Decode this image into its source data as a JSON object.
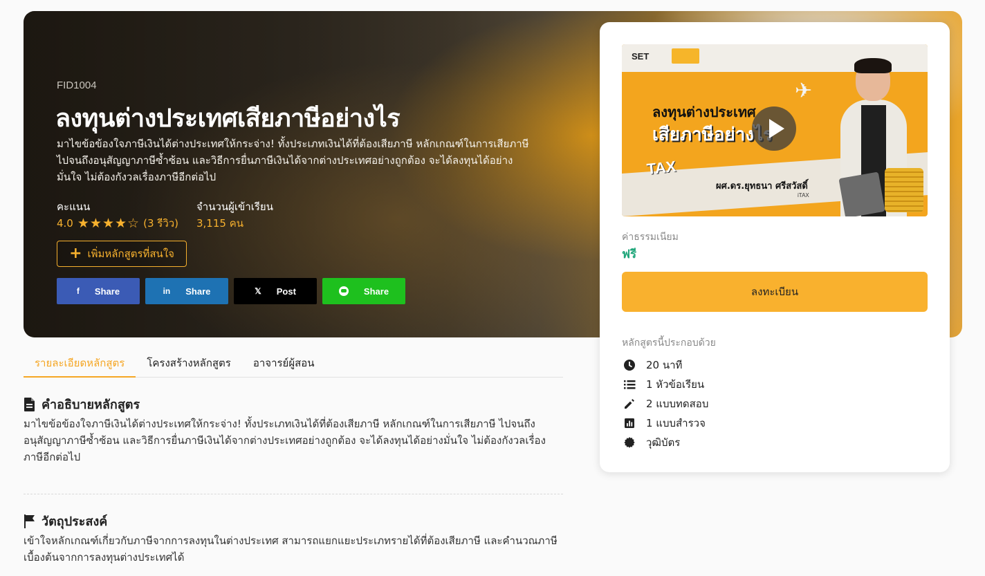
{
  "hero": {
    "code": "FID1004",
    "title": "ลงทุนต่างประเทศเสียภาษีอย่างไร",
    "description": "มาไขข้อข้องใจภาษีเงินได้ต่างประเทศให้กระจ่าง! ทั้งประเภทเงินได้ที่ต้องเสียภาษี หลักเกณฑ์ในการเสียภาษี ไปจนถึงอนุสัญญาภาษีซ้ำซ้อน และวิธีการยื่นภาษีเงินได้จากต่างประเทศอย่างถูกต้อง จะได้ลงทุนได้อย่างมั่นใจ ไม่ต้องกังวลเรื่องภาษีอีกต่อไป",
    "rating_label": "คะแนน",
    "rating_value": "4.0",
    "rating_stars": 4,
    "reviews": "(3 รีวิว)",
    "students_label": "จำนวนผู้เข้าเรียน",
    "students_value": "3,115 คน",
    "follow_label": "เพิ่มหลักสูตรที่สนใจ",
    "share": {
      "facebook": "Share",
      "linkedin": "Share",
      "x": "Post",
      "line": "Share"
    },
    "colors": {
      "accent": "#f7b12e",
      "facebook": "#3b5bb5",
      "linkedin": "#1e72b3",
      "x": "#000000",
      "line": "#1ec01e"
    }
  },
  "tabs": [
    "รายละเอียดหลักสูตร",
    "โครงสร้างหลักสูตร",
    "อาจารย์ผู้สอน"
  ],
  "description_section": {
    "heading": "คำอธิบายหลักสูตร",
    "text": "มาไขข้อข้องใจภาษีเงินได้ต่างประเทศให้กระจ่าง! ทั้งประเภทเงินได้ที่ต้องเสียภาษี หลักเกณฑ์ในการเสียภาษี ไปจนถึงอนุสัญญาภาษีซ้ำซ้อน และวิธีการยื่นภาษีเงินได้จากต่างประเทศอย่างถูกต้อง จะได้ลงทุนได้อย่างมั่นใจ ไม่ต้องกังวลเรื่องภาษีอีกต่อไป"
  },
  "objective_section": {
    "heading": "วัตถุประสงค์",
    "text": "เข้าใจหลักเกณฑ์เกี่ยวกับภาษีจากการลงทุนในต่างประเทศ สามารถแยกแยะประเภทรายได้ที่ต้องเสียภาษี และคำนวณภาษีเบื้องต้นจากการลงทุนต่างประเทศได้"
  },
  "card": {
    "thumbnail": {
      "logo": "SET",
      "title_line1": "ลงทุนต่างประเทศ",
      "title_line2": "เสียภาษีอย่างไร",
      "tax": "TAX",
      "speaker": "ผศ.ดร.ยุทธนา ศรีสวัสดิ์",
      "org": "iTAX"
    },
    "fee_label": "ค่าธรรมเนียม",
    "fee_value": "ฟรี",
    "enroll_label": "ลงทะเบียน",
    "includes_label": "หลักสูตรนี้ประกอบด้วย",
    "includes": [
      {
        "icon": "clock-icon",
        "text": "20 นาที"
      },
      {
        "icon": "list-icon",
        "text": "1 หัวข้อเรียน"
      },
      {
        "icon": "pencil-icon",
        "text": "2 แบบทดสอบ"
      },
      {
        "icon": "chart-icon",
        "text": "1 แบบสำรวจ"
      },
      {
        "icon": "certificate-icon",
        "text": "วุฒิบัตร"
      }
    ],
    "colors": {
      "fee": "#1fa67a",
      "enroll": "#f9b12e"
    }
  }
}
